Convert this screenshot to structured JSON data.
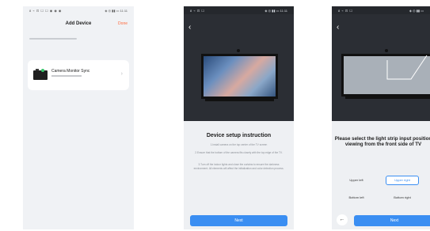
{
  "screen1": {
    "status_left": "8 ⌁ ⊡ ☐ ☐ ◉ ◉ ◉",
    "status_right": "◈ ◎ ▮▮ ▭ 11:11",
    "title": "Add Device",
    "done_label": "Done",
    "device_name": "Camera Monitor Sync",
    "chevron": "›"
  },
  "screen2": {
    "status_left": "8 ⌁ ⊡ ☐",
    "status_right": "◈ ◎ ▮▮ ▭ 11:11",
    "back": "‹",
    "title": "Device setup instruction",
    "instructions": [
      "1.Install camera on the top center of the TV screen",
      "2.Ensure that the bottom of the camera fits closely with the top edge of the TV.",
      "3.Turn off the indoor lights and close the curtains to ensure the darkness environment. All elements will affect the initialization and color detection process."
    ],
    "next_label": "Next"
  },
  "screen3": {
    "status_left": "8 ⌁ ⊡ ☐",
    "status_right": "◈ ◎ ▮▮ ▭",
    "back": "‹",
    "title": "Please select the light strip input position viewing from the front side of TV",
    "options": {
      "upper_left": "Upper left",
      "upper_right": "Upper right",
      "bottom_left": "Bottom left",
      "bottom_right": "Bottom right"
    },
    "prev_arrow": "←",
    "next_label": "Next"
  },
  "colors": {
    "accent": "#3a8ef2",
    "done": "#ff6a3d",
    "dark_header": "#2b2e34"
  }
}
